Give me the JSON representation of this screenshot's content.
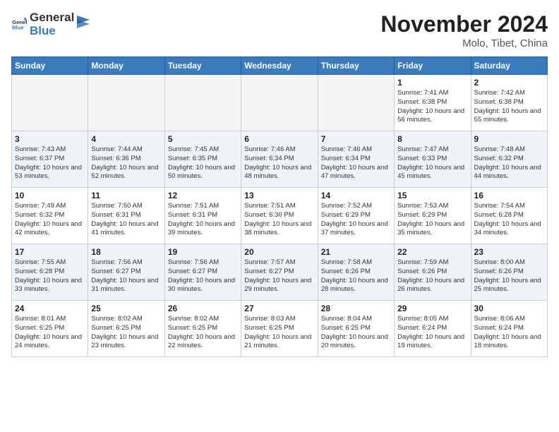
{
  "header": {
    "logo_general": "General",
    "logo_blue": "Blue",
    "title": "November 2024",
    "location": "Molo, Tibet, China"
  },
  "weekdays": [
    "Sunday",
    "Monday",
    "Tuesday",
    "Wednesday",
    "Thursday",
    "Friday",
    "Saturday"
  ],
  "weeks": [
    [
      {
        "day": "",
        "info": ""
      },
      {
        "day": "",
        "info": ""
      },
      {
        "day": "",
        "info": ""
      },
      {
        "day": "",
        "info": ""
      },
      {
        "day": "",
        "info": ""
      },
      {
        "day": "1",
        "info": "Sunrise: 7:41 AM\nSunset: 6:38 PM\nDaylight: 10 hours and 56 minutes."
      },
      {
        "day": "2",
        "info": "Sunrise: 7:42 AM\nSunset: 6:38 PM\nDaylight: 10 hours and 55 minutes."
      }
    ],
    [
      {
        "day": "3",
        "info": "Sunrise: 7:43 AM\nSunset: 6:37 PM\nDaylight: 10 hours and 53 minutes."
      },
      {
        "day": "4",
        "info": "Sunrise: 7:44 AM\nSunset: 6:36 PM\nDaylight: 10 hours and 52 minutes."
      },
      {
        "day": "5",
        "info": "Sunrise: 7:45 AM\nSunset: 6:35 PM\nDaylight: 10 hours and 50 minutes."
      },
      {
        "day": "6",
        "info": "Sunrise: 7:46 AM\nSunset: 6:34 PM\nDaylight: 10 hours and 48 minutes."
      },
      {
        "day": "7",
        "info": "Sunrise: 7:46 AM\nSunset: 6:34 PM\nDaylight: 10 hours and 47 minutes."
      },
      {
        "day": "8",
        "info": "Sunrise: 7:47 AM\nSunset: 6:33 PM\nDaylight: 10 hours and 45 minutes."
      },
      {
        "day": "9",
        "info": "Sunrise: 7:48 AM\nSunset: 6:32 PM\nDaylight: 10 hours and 44 minutes."
      }
    ],
    [
      {
        "day": "10",
        "info": "Sunrise: 7:49 AM\nSunset: 6:32 PM\nDaylight: 10 hours and 42 minutes."
      },
      {
        "day": "11",
        "info": "Sunrise: 7:50 AM\nSunset: 6:31 PM\nDaylight: 10 hours and 41 minutes."
      },
      {
        "day": "12",
        "info": "Sunrise: 7:51 AM\nSunset: 6:31 PM\nDaylight: 10 hours and 39 minutes."
      },
      {
        "day": "13",
        "info": "Sunrise: 7:51 AM\nSunset: 6:30 PM\nDaylight: 10 hours and 38 minutes."
      },
      {
        "day": "14",
        "info": "Sunrise: 7:52 AM\nSunset: 6:29 PM\nDaylight: 10 hours and 37 minutes."
      },
      {
        "day": "15",
        "info": "Sunrise: 7:53 AM\nSunset: 6:29 PM\nDaylight: 10 hours and 35 minutes."
      },
      {
        "day": "16",
        "info": "Sunrise: 7:54 AM\nSunset: 6:28 PM\nDaylight: 10 hours and 34 minutes."
      }
    ],
    [
      {
        "day": "17",
        "info": "Sunrise: 7:55 AM\nSunset: 6:28 PM\nDaylight: 10 hours and 33 minutes."
      },
      {
        "day": "18",
        "info": "Sunrise: 7:56 AM\nSunset: 6:27 PM\nDaylight: 10 hours and 31 minutes."
      },
      {
        "day": "19",
        "info": "Sunrise: 7:56 AM\nSunset: 6:27 PM\nDaylight: 10 hours and 30 minutes."
      },
      {
        "day": "20",
        "info": "Sunrise: 7:57 AM\nSunset: 6:27 PM\nDaylight: 10 hours and 29 minutes."
      },
      {
        "day": "21",
        "info": "Sunrise: 7:58 AM\nSunset: 6:26 PM\nDaylight: 10 hours and 28 minutes."
      },
      {
        "day": "22",
        "info": "Sunrise: 7:59 AM\nSunset: 6:26 PM\nDaylight: 10 hours and 26 minutes."
      },
      {
        "day": "23",
        "info": "Sunrise: 8:00 AM\nSunset: 6:26 PM\nDaylight: 10 hours and 25 minutes."
      }
    ],
    [
      {
        "day": "24",
        "info": "Sunrise: 8:01 AM\nSunset: 6:25 PM\nDaylight: 10 hours and 24 minutes."
      },
      {
        "day": "25",
        "info": "Sunrise: 8:02 AM\nSunset: 6:25 PM\nDaylight: 10 hours and 23 minutes."
      },
      {
        "day": "26",
        "info": "Sunrise: 8:02 AM\nSunset: 6:25 PM\nDaylight: 10 hours and 22 minutes."
      },
      {
        "day": "27",
        "info": "Sunrise: 8:03 AM\nSunset: 6:25 PM\nDaylight: 10 hours and 21 minutes."
      },
      {
        "day": "28",
        "info": "Sunrise: 8:04 AM\nSunset: 6:25 PM\nDaylight: 10 hours and 20 minutes."
      },
      {
        "day": "29",
        "info": "Sunrise: 8:05 AM\nSunset: 6:24 PM\nDaylight: 10 hours and 19 minutes."
      },
      {
        "day": "30",
        "info": "Sunrise: 8:06 AM\nSunset: 6:24 PM\nDaylight: 10 hours and 18 minutes."
      }
    ]
  ]
}
